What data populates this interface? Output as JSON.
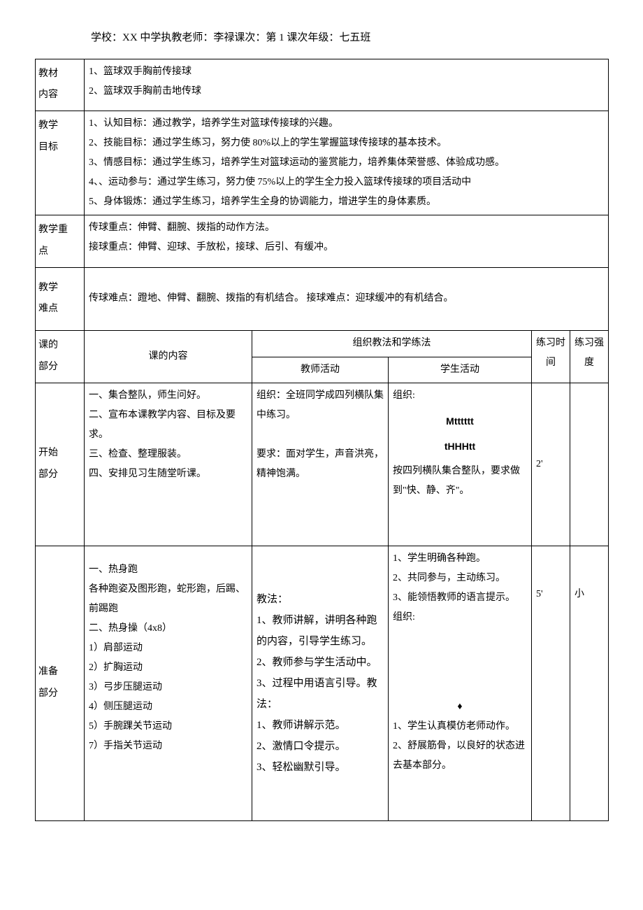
{
  "header": "学校：XX 中学执教老师：李禄课次：第 1 课次年级：七五班",
  "row_labels": {
    "material": "教材\n内容",
    "goals": "教学\n目标",
    "key": "教学重\n点",
    "difficulty": "教学\n难点",
    "part": "课的\n部分",
    "start": "开始\n部分",
    "prep": "准备\n部分"
  },
  "material": "1、篮球双手胸前传接球\n2、篮球双手胸前击地传球",
  "goals": "1、认知目标：通过教学，培养学生对篮球传接球的兴趣。\n2、技能目标：通过学生练习，努力使 80%以上的学生掌握篮球传接球的基本技术。\n3、情感目标：通过学生练习，培养学生对篮球运动的鉴赏能力，培养集体荣誉感、体验成功感。\n4、、运动参与：通过学生练习，努力使 75%以上的学生全力投入篮球传接球的项目活动中\n5、身体锻炼：通过学生练习，培养学生全身的协调能力，增进学生的身体素质。",
  "key": "传球重点：伸臂、翻腕、拨指的动作方法。\n接球重点：伸臂、迎球、手放松，接球、后引、有缓冲。",
  "difficulty": "传球难点：蹬地、伸臂、翻腕、拨指的有机结合。 接球难点：迎球缓冲的有机结合。",
  "headers": {
    "content": "课的内容",
    "methods": "组织教法和学练法",
    "teacher": "教师活动",
    "student": "学生活动",
    "time": "练习时\n间",
    "intensity": "练习强\n度"
  },
  "start": {
    "content": "一、集合整队，师生问好。\n二、宣布本课教学内容、目标及要求。\n三、检查、整理服装。\n四、安排见习生随堂听课。",
    "teacher": "组织：全班同学成四列横队集中练习。\n\n要求：面对学生，声音洪亮，精神饱满。",
    "student_top": "组织:",
    "formation1": "Mtttttt",
    "formation2": "tHHHtt",
    "student_bottom": "按四列横队集合整队，要求做到\"快、静、齐\"。",
    "time": "2'",
    "intensity": ""
  },
  "prep": {
    "content": "一、热身跑\n各种跑姿及图形跑，蛇形跑，后踢、前踢跑\n二、热身操（4x8）\n1）肩部运动\n2）扩胸运动\n3）弓步压腿运动\n4）侧压腿运动\n5）手腕踝关节运动\n7）手指关节运动",
    "teacher": "教法：\n1、教师讲解，讲明各种跑的内容，引导学生练习。\n2、教师参与学生活动中。\n3、过程中用语言引导。教法：\n1、教师讲解示范。\n2、激情口令提示。\n3、轻松幽默引导。",
    "student_top": "1、学生明确各种跑。\n2、共同参与，主动练习。\n3、能领悟教师的语言提示。\n组织:",
    "diamond": "♦",
    "student_bottom": "1、学生认真模仿老师动作。\n2、舒展筋骨，以良好的状态进去基本部分。",
    "time": "5'",
    "intensity": "小"
  }
}
